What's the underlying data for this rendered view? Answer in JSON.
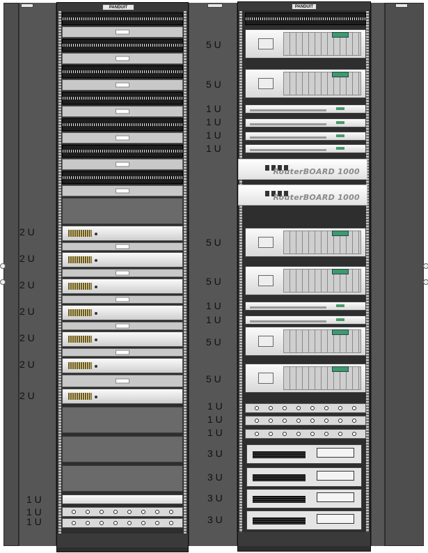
{
  "brand": {
    "name": "PANDUIT"
  },
  "left_rack": {
    "unit_labels": [
      "2 U",
      "2 U",
      "2 U",
      "2 U",
      "2 U",
      "2 U",
      "2 U",
      "1 U",
      "1 U",
      "1 U"
    ],
    "devices": [
      "patch-panel",
      "cable-manager",
      "patch-panel",
      "cable-manager",
      "patch-panel",
      "cable-manager",
      "patch-panel",
      "cable-manager",
      "patch-panel",
      "cable-manager",
      "patch-panel",
      "cable-manager",
      "patch-panel",
      "cable-manager",
      "blank-panel",
      "switch",
      "switch",
      "switch",
      "switch",
      "switch",
      "switch",
      "switch",
      "blank-panel",
      "blank-panel",
      "blank-panel",
      "1u-panel",
      "power-strip",
      "power-strip"
    ]
  },
  "right_rack": {
    "unit_labels": [
      "5 U",
      "5 U",
      "1 U",
      "1 U",
      "1 U",
      "1 U",
      "5 U",
      "5 U",
      "1 U",
      "1 U",
      "5 U",
      "5 U",
      "1 U",
      "1 U",
      "1 U",
      "3 U",
      "3 U",
      "3 U",
      "3 U"
    ],
    "router_label": "RouterBOARD 1000",
    "devices": [
      "patch-panel",
      "server-5u",
      "server-5u",
      "server-1u",
      "server-1u",
      "server-1u",
      "server-1u",
      "router",
      "router",
      "server-5u",
      "server-5u",
      "server-1u",
      "server-1u",
      "server-5u",
      "server-5u",
      "power-strip",
      "power-strip",
      "power-strip",
      "amplifier-3u",
      "amplifier-3u",
      "amplifier-3u",
      "amplifier-3u"
    ]
  }
}
